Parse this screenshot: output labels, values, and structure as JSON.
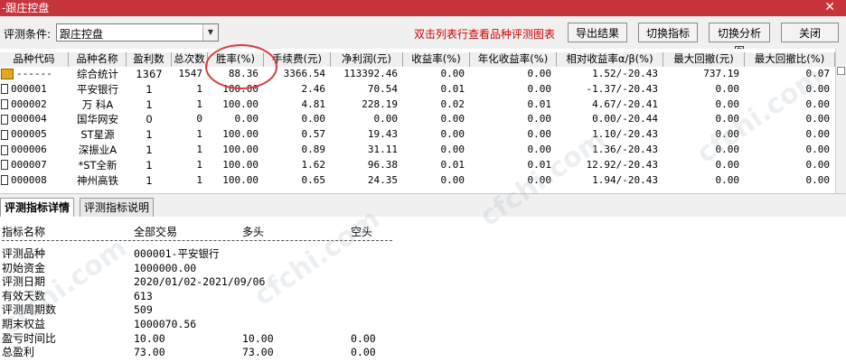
{
  "window": {
    "title": "-跟庄控盘",
    "close_glyph": "✕"
  },
  "toolbar": {
    "condition_label": "评测条件:",
    "condition_value": "跟庄控盘",
    "hint": "双击列表行查看品种评测图表",
    "buttons": [
      "导出结果",
      "切换指标",
      "切换分析图",
      "关闭"
    ]
  },
  "table": {
    "headers": [
      "品种代码",
      "品种名称",
      "盈利数",
      "总次数",
      "胜率(%)",
      "手续费(元)",
      "净利润(元)",
      "收益率(%)",
      "年化收益率(%)",
      "相对收益率α/β(%)",
      "最大回撤(元)",
      "最大回撤比(%)"
    ],
    "rows": [
      {
        "code": "------",
        "name": "综合统计",
        "profit_count": "1367",
        "total": "1547",
        "win_rate": "88.36",
        "fee": "3366.54",
        "net_profit": "113392.46",
        "return": "0.00",
        "annual": "0.00",
        "relative": "1.52/-20.43",
        "max_dd": "737.19",
        "max_dd_ratio": "0.07"
      },
      {
        "code": "000001",
        "name": "平安银行",
        "profit_count": "1",
        "total": "1",
        "win_rate": "100.00",
        "fee": "2.46",
        "net_profit": "70.54",
        "return": "0.01",
        "annual": "0.00",
        "relative": "-1.37/-20.43",
        "max_dd": "0.00",
        "max_dd_ratio": "0.00"
      },
      {
        "code": "000002",
        "name": "万 科A",
        "profit_count": "1",
        "total": "1",
        "win_rate": "100.00",
        "fee": "4.81",
        "net_profit": "228.19",
        "return": "0.02",
        "annual": "0.01",
        "relative": "4.67/-20.41",
        "max_dd": "0.00",
        "max_dd_ratio": "0.00"
      },
      {
        "code": "000004",
        "name": "国华网安",
        "profit_count": "0",
        "total": "0",
        "win_rate": "0.00",
        "fee": "0.00",
        "net_profit": "0.00",
        "return": "0.00",
        "annual": "0.00",
        "relative": "0.00/-20.44",
        "max_dd": "0.00",
        "max_dd_ratio": "0.00"
      },
      {
        "code": "000005",
        "name": "ST星源",
        "profit_count": "1",
        "total": "1",
        "win_rate": "100.00",
        "fee": "0.57",
        "net_profit": "19.43",
        "return": "0.00",
        "annual": "0.00",
        "relative": "1.10/-20.43",
        "max_dd": "0.00",
        "max_dd_ratio": "0.00"
      },
      {
        "code": "000006",
        "name": "深振业A",
        "profit_count": "1",
        "total": "1",
        "win_rate": "100.00",
        "fee": "0.89",
        "net_profit": "31.11",
        "return": "0.00",
        "annual": "0.00",
        "relative": "1.36/-20.43",
        "max_dd": "0.00",
        "max_dd_ratio": "0.00"
      },
      {
        "code": "000007",
        "name": "*ST全新",
        "profit_count": "1",
        "total": "1",
        "win_rate": "100.00",
        "fee": "1.62",
        "net_profit": "96.38",
        "return": "0.01",
        "annual": "0.01",
        "relative": "12.92/-20.43",
        "max_dd": "0.00",
        "max_dd_ratio": "0.00"
      },
      {
        "code": "000008",
        "name": "神州高铁",
        "profit_count": "1",
        "total": "1",
        "win_rate": "100.00",
        "fee": "0.65",
        "net_profit": "24.35",
        "return": "0.00",
        "annual": "0.00",
        "relative": "1.94/-20.43",
        "max_dd": "0.00",
        "max_dd_ratio": "0.00"
      }
    ]
  },
  "tabs": [
    "评测指标详情",
    "评测指标说明"
  ],
  "detail": {
    "headers": [
      "指标名称",
      "全部交易",
      "多头",
      "空头"
    ],
    "rows": [
      {
        "label": "评测品种",
        "all": "000001-平安银行",
        "long": "",
        "short": ""
      },
      {
        "label": "初始资金",
        "all": "1000000.00",
        "long": "",
        "short": ""
      },
      {
        "label": "评测日期",
        "all": "2020/01/02-2021/09/06",
        "long": "",
        "short": ""
      },
      {
        "label": "有效天数",
        "all": "613",
        "long": "",
        "short": ""
      },
      {
        "label": "评测周期数",
        "all": "509",
        "long": "",
        "short": ""
      },
      {
        "label": "期末权益",
        "all": "1000070.56",
        "long": "",
        "short": ""
      },
      {
        "label": "盈亏时间比",
        "all": "10.00",
        "long": "10.00",
        "short": "0.00"
      },
      {
        "label": "总盈利",
        "all": "73.00",
        "long": "73.00",
        "short": "0.00"
      }
    ]
  },
  "watermark": "cfchi.com"
}
